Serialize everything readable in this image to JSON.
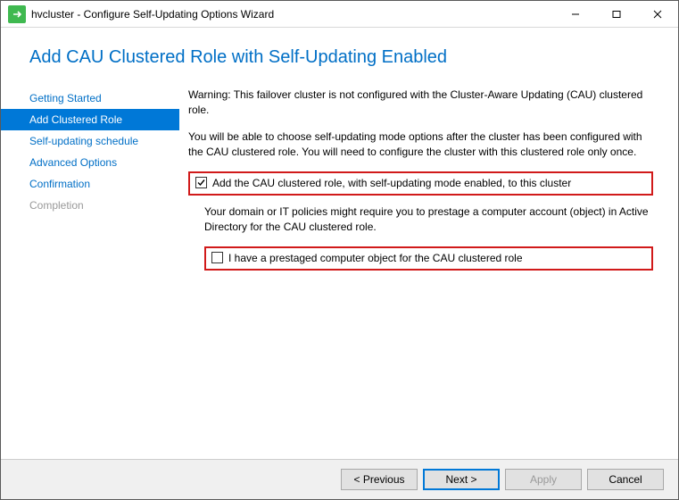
{
  "window": {
    "title": "hvcluster - Configure Self-Updating Options Wizard"
  },
  "pageTitle": "Add CAU Clustered Role with Self-Updating Enabled",
  "sidebar": {
    "items": [
      {
        "label": "Getting Started"
      },
      {
        "label": "Add Clustered Role"
      },
      {
        "label": "Self-updating schedule"
      },
      {
        "label": "Advanced Options"
      },
      {
        "label": "Confirmation"
      },
      {
        "label": "Completion"
      }
    ]
  },
  "main": {
    "warning": "Warning: This failover cluster is not configured with the Cluster-Aware Updating (CAU) clustered role.",
    "desc": "You will be able to choose self-updating mode options after the cluster has been configured with the CAU clustered role. You will need to configure the cluster with this clustered role only once.",
    "chk1_label": "Add the CAU clustered role, with self-updating mode enabled, to this cluster",
    "prestage_desc": "Your domain or IT policies might require you to prestage a computer account (object) in Active Directory for the CAU clustered role.",
    "chk2_label": "I have a prestaged computer object for the CAU clustered role"
  },
  "footer": {
    "previous": "< Previous",
    "next": "Next >",
    "apply": "Apply",
    "cancel": "Cancel"
  }
}
